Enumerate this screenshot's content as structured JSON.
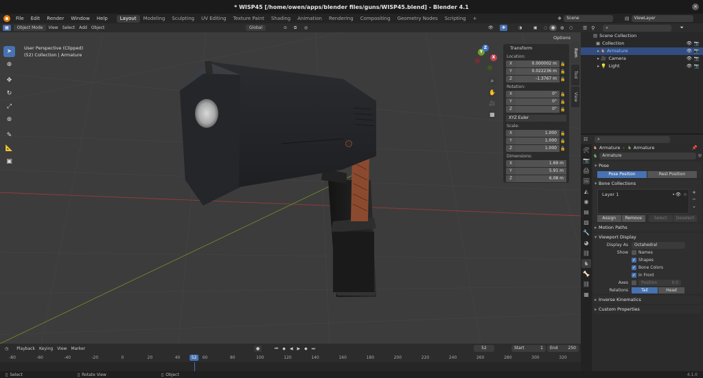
{
  "title": "* WISP45 [/home/owen/apps/blender files/guns/WISP45.blend] - Blender 4.1",
  "menu": [
    "File",
    "Edit",
    "Render",
    "Window",
    "Help"
  ],
  "workspaces": [
    "Layout",
    "Modeling",
    "Sculpting",
    "UV Editing",
    "Texture Paint",
    "Shading",
    "Animation",
    "Rendering",
    "Compositing",
    "Geometry Nodes",
    "Scripting"
  ],
  "active_workspace": "Layout",
  "add_tab": "+",
  "scene": "Scene",
  "view_layer": "ViewLayer",
  "viewport": {
    "mode": "Object Mode",
    "menus": [
      "View",
      "Select",
      "Add",
      "Object"
    ],
    "orientation": "Global",
    "options": "Options",
    "info_line1": "User Perspective (Clipped)",
    "info_line2": "(52) Collection | Armature"
  },
  "npanel": {
    "header": "Transform",
    "location_label": "Location:",
    "location": [
      {
        "axis": "X",
        "value": "0.000002 m"
      },
      {
        "axis": "Y",
        "value": "0.022236 m"
      },
      {
        "axis": "Z",
        "value": "-1.3767 m"
      }
    ],
    "rotation_label": "Rotation:",
    "rotation": [
      {
        "axis": "X",
        "value": "0°"
      },
      {
        "axis": "Y",
        "value": "0°"
      },
      {
        "axis": "Z",
        "value": "0°"
      }
    ],
    "rotation_mode": "XYZ Euler",
    "scale_label": "Scale:",
    "scale": [
      {
        "axis": "X",
        "value": "1.000"
      },
      {
        "axis": "Y",
        "value": "1.000"
      },
      {
        "axis": "Z",
        "value": "1.000"
      }
    ],
    "dimensions_label": "Dimensions:",
    "dimensions": [
      {
        "axis": "X",
        "value": "1.69 m"
      },
      {
        "axis": "Y",
        "value": "5.91 m"
      },
      {
        "axis": "Z",
        "value": "6.08 m"
      }
    ],
    "tabs": [
      "Item",
      "Tool",
      "View"
    ]
  },
  "gizmo": {
    "x": "X",
    "y": "Y",
    "z": "Z"
  },
  "outliner": {
    "search_placeholder": "",
    "scene_collection": "Scene Collection",
    "items": [
      {
        "label": "Collection",
        "level": 0,
        "selected": false
      },
      {
        "label": "Armature",
        "level": 1,
        "selected": true
      },
      {
        "label": "Camera",
        "level": 1,
        "selected": false
      },
      {
        "label": "Light",
        "level": 1,
        "selected": false
      }
    ]
  },
  "properties": {
    "breadcrumb_object": "Armature",
    "breadcrumb_data": "Armature",
    "data_name": "Armature",
    "pose": {
      "title": "Pose",
      "pose_position": "Pose Position",
      "rest_position": "Rest Position"
    },
    "bone_collections": {
      "title": "Bone Collections",
      "layer": "Layer 1",
      "assign": "Assign",
      "remove": "Remove",
      "select": "Select",
      "deselect": "Deselect"
    },
    "motion_paths": "Motion Paths",
    "viewport_display": {
      "title": "Viewport Display",
      "display_as_label": "Display As",
      "display_as": "Octahedral",
      "show_label": "Show",
      "names": "Names",
      "shapes": "Shapes",
      "bone_colors": "Bone Colors",
      "in_front": "In Front",
      "axes_label": "Axes",
      "position_label": "Position",
      "position_value": "0.0",
      "relations_label": "Relations",
      "tail": "Tail",
      "head": "Head"
    },
    "inverse_kinematics": "Inverse Kinematics",
    "custom_properties": "Custom Properties"
  },
  "timeline": {
    "menus": [
      "Playback",
      "Keying",
      "View",
      "Marker"
    ],
    "current_frame": "52",
    "start_label": "Start",
    "start": "1",
    "end_label": "End",
    "end": "250",
    "ticks": [
      "-80",
      "-60",
      "-40",
      "-20",
      "0",
      "20",
      "40",
      "60",
      "80",
      "100",
      "120",
      "140",
      "160",
      "180",
      "200",
      "220",
      "240",
      "260",
      "280",
      "300",
      "320"
    ]
  },
  "status": {
    "select": "Select",
    "rotate": "Rotate View",
    "object": "Object",
    "version": "4.1.0"
  },
  "colors": {
    "accent": "#4772b3",
    "selection": "#334d80",
    "grid_x": "#9a3b3b",
    "grid_y": "#6e8a2a"
  }
}
